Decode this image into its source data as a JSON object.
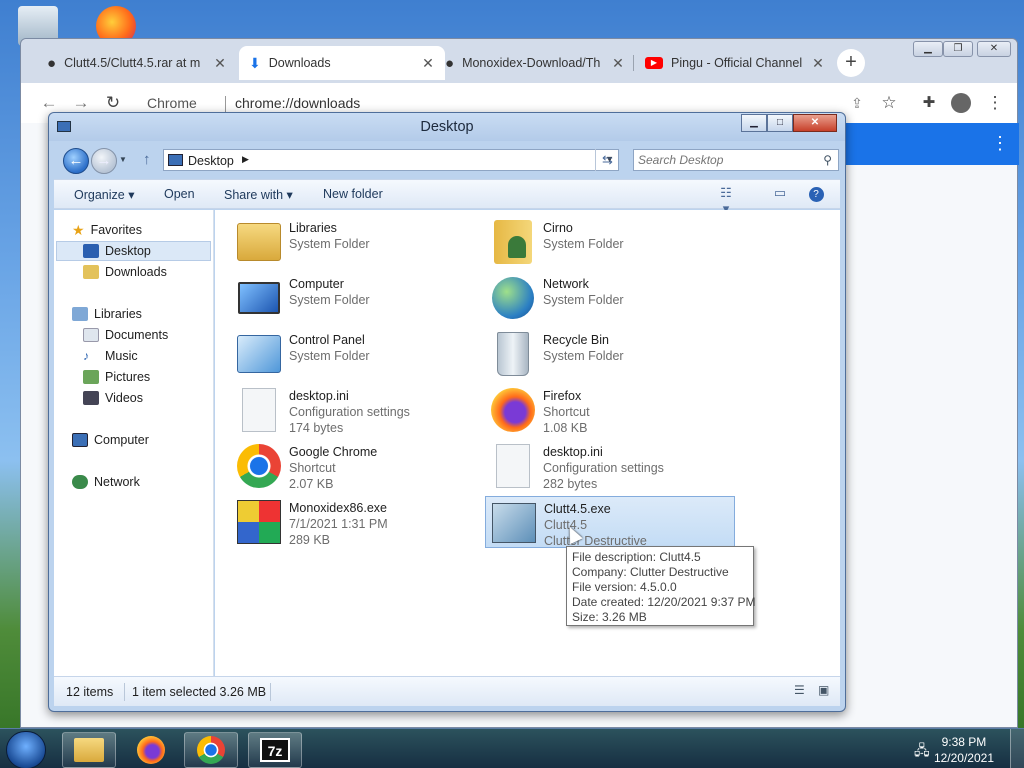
{
  "chrome": {
    "tabs": [
      {
        "title": "Clutt4.5/Clutt4.5.rar at m",
        "icon": "github-icon"
      },
      {
        "title": "Downloads",
        "icon": "download-icon"
      },
      {
        "title": "Monoxidex-Download/Th",
        "icon": "github-icon"
      },
      {
        "title": "Pingu - Official Channel",
        "icon": "youtube-icon"
      }
    ],
    "new_tab": "+",
    "omnibox": {
      "chip": "Chrome",
      "url": "chrome://downloads"
    }
  },
  "explorer": {
    "title": "Desktop",
    "address": "Desktop",
    "search_placeholder": "Search Desktop",
    "commands": {
      "organize": "Organize",
      "open": "Open",
      "share": "Share with",
      "new_folder": "New folder"
    },
    "nav": {
      "favorites": "Favorites",
      "desktop": "Desktop",
      "downloads": "Downloads",
      "libraries": "Libraries",
      "documents": "Documents",
      "music": "Music",
      "pictures": "Pictures",
      "videos": "Videos",
      "computer": "Computer",
      "network": "Network"
    },
    "files": [
      {
        "name": "Libraries",
        "line2": "System Folder",
        "line3": ""
      },
      {
        "name": "Cirno",
        "line2": "System Folder",
        "line3": ""
      },
      {
        "name": "Computer",
        "line2": "System Folder",
        "line3": ""
      },
      {
        "name": "Network",
        "line2": "System Folder",
        "line3": ""
      },
      {
        "name": "Control Panel",
        "line2": "System Folder",
        "line3": ""
      },
      {
        "name": "Recycle Bin",
        "line2": "System Folder",
        "line3": ""
      },
      {
        "name": "desktop.ini",
        "line2": "Configuration settings",
        "line3": "174 bytes"
      },
      {
        "name": "Firefox",
        "line2": "Shortcut",
        "line3": "1.08 KB"
      },
      {
        "name": "Google Chrome",
        "line2": "Shortcut",
        "line3": "2.07 KB"
      },
      {
        "name": "desktop.ini",
        "line2": "Configuration settings",
        "line3": "282 bytes"
      },
      {
        "name": "Monoxidex86.exe",
        "line2": "7/1/2021 1:31 PM",
        "line3": "289 KB"
      },
      {
        "name": "Clutt4.5.exe",
        "line2": "Clutt4.5",
        "line3": "Clutter Destructive"
      }
    ],
    "tooltip": [
      "File description: Clutt4.5",
      "Company: Clutter Destructive",
      "File version: 4.5.0.0",
      "Date created: 12/20/2021 9:37 PM",
      "Size: 3.26 MB"
    ],
    "status": {
      "count": "12 items",
      "selected": "1 item selected  3.26 MB"
    }
  },
  "taskbar": {
    "time": "9:38 PM",
    "date": "12/20/2021",
    "sevenzip_label": "7z"
  }
}
